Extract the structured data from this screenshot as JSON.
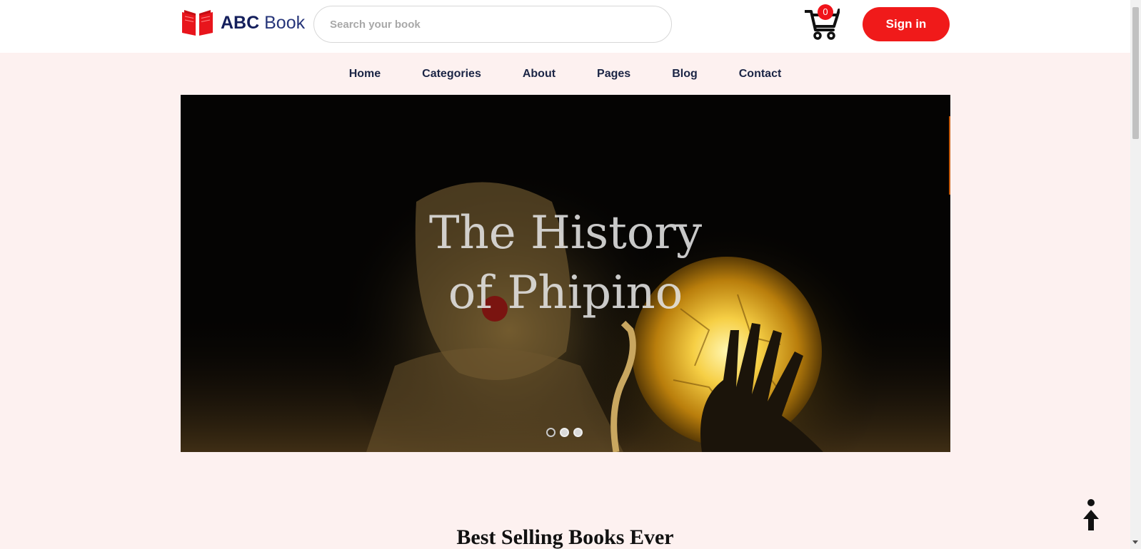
{
  "header": {
    "logo": {
      "strong": "ABC",
      "light": "Book",
      "icon": "open-book-icon",
      "color": "#e8151c"
    },
    "search": {
      "placeholder": "Search your book",
      "value": ""
    },
    "cart": {
      "count": "0",
      "icon": "shopping-cart-icon"
    },
    "signin_label": "Sign in"
  },
  "nav": {
    "items": [
      {
        "label": "Home"
      },
      {
        "label": "Categories"
      },
      {
        "label": "About"
      },
      {
        "label": "Pages"
      },
      {
        "label": "Blog"
      },
      {
        "label": "Contact"
      }
    ]
  },
  "hero": {
    "title_line1": "The History",
    "title_line2": "of Phipino",
    "slides": 3,
    "active_slide": 1
  },
  "sections": {
    "best_selling_title": "Best Selling Books Ever"
  },
  "back_to_top": {
    "icon": "arrow-up-icon"
  },
  "colors": {
    "accent": "#f01a1a",
    "page_background": "#fdf1f0",
    "nav_text": "#1b2545"
  }
}
